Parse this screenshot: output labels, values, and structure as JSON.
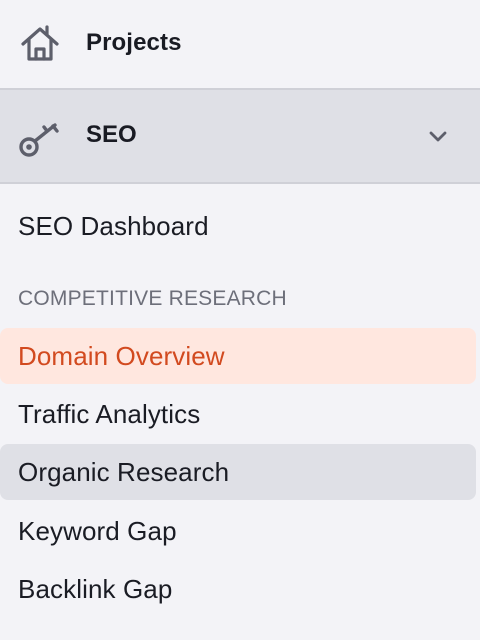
{
  "sidebar": {
    "projects": {
      "label": "Projects",
      "icon": "home-icon"
    },
    "tool": {
      "label": "SEO",
      "icon": "key-icon",
      "expanded": true
    },
    "items": [
      {
        "label": "SEO Dashboard",
        "state": "normal"
      }
    ],
    "sections": [
      {
        "heading": "COMPETITIVE RESEARCH",
        "items": [
          {
            "label": "Domain Overview",
            "state": "active"
          },
          {
            "label": "Traffic Analytics",
            "state": "normal"
          },
          {
            "label": "Organic Research",
            "state": "hover"
          },
          {
            "label": "Keyword Gap",
            "state": "normal"
          },
          {
            "label": "Backlink Gap",
            "state": "normal"
          }
        ]
      }
    ]
  },
  "colors": {
    "background": "#f3f3f7",
    "header_band": "#dfe0e6",
    "active_bg": "#ffe7df",
    "active_text": "#d24a1f",
    "hover_bg": "#dfe0e6",
    "heading_text": "#6d6f7a",
    "icon_gray": "#5d5f6b"
  }
}
